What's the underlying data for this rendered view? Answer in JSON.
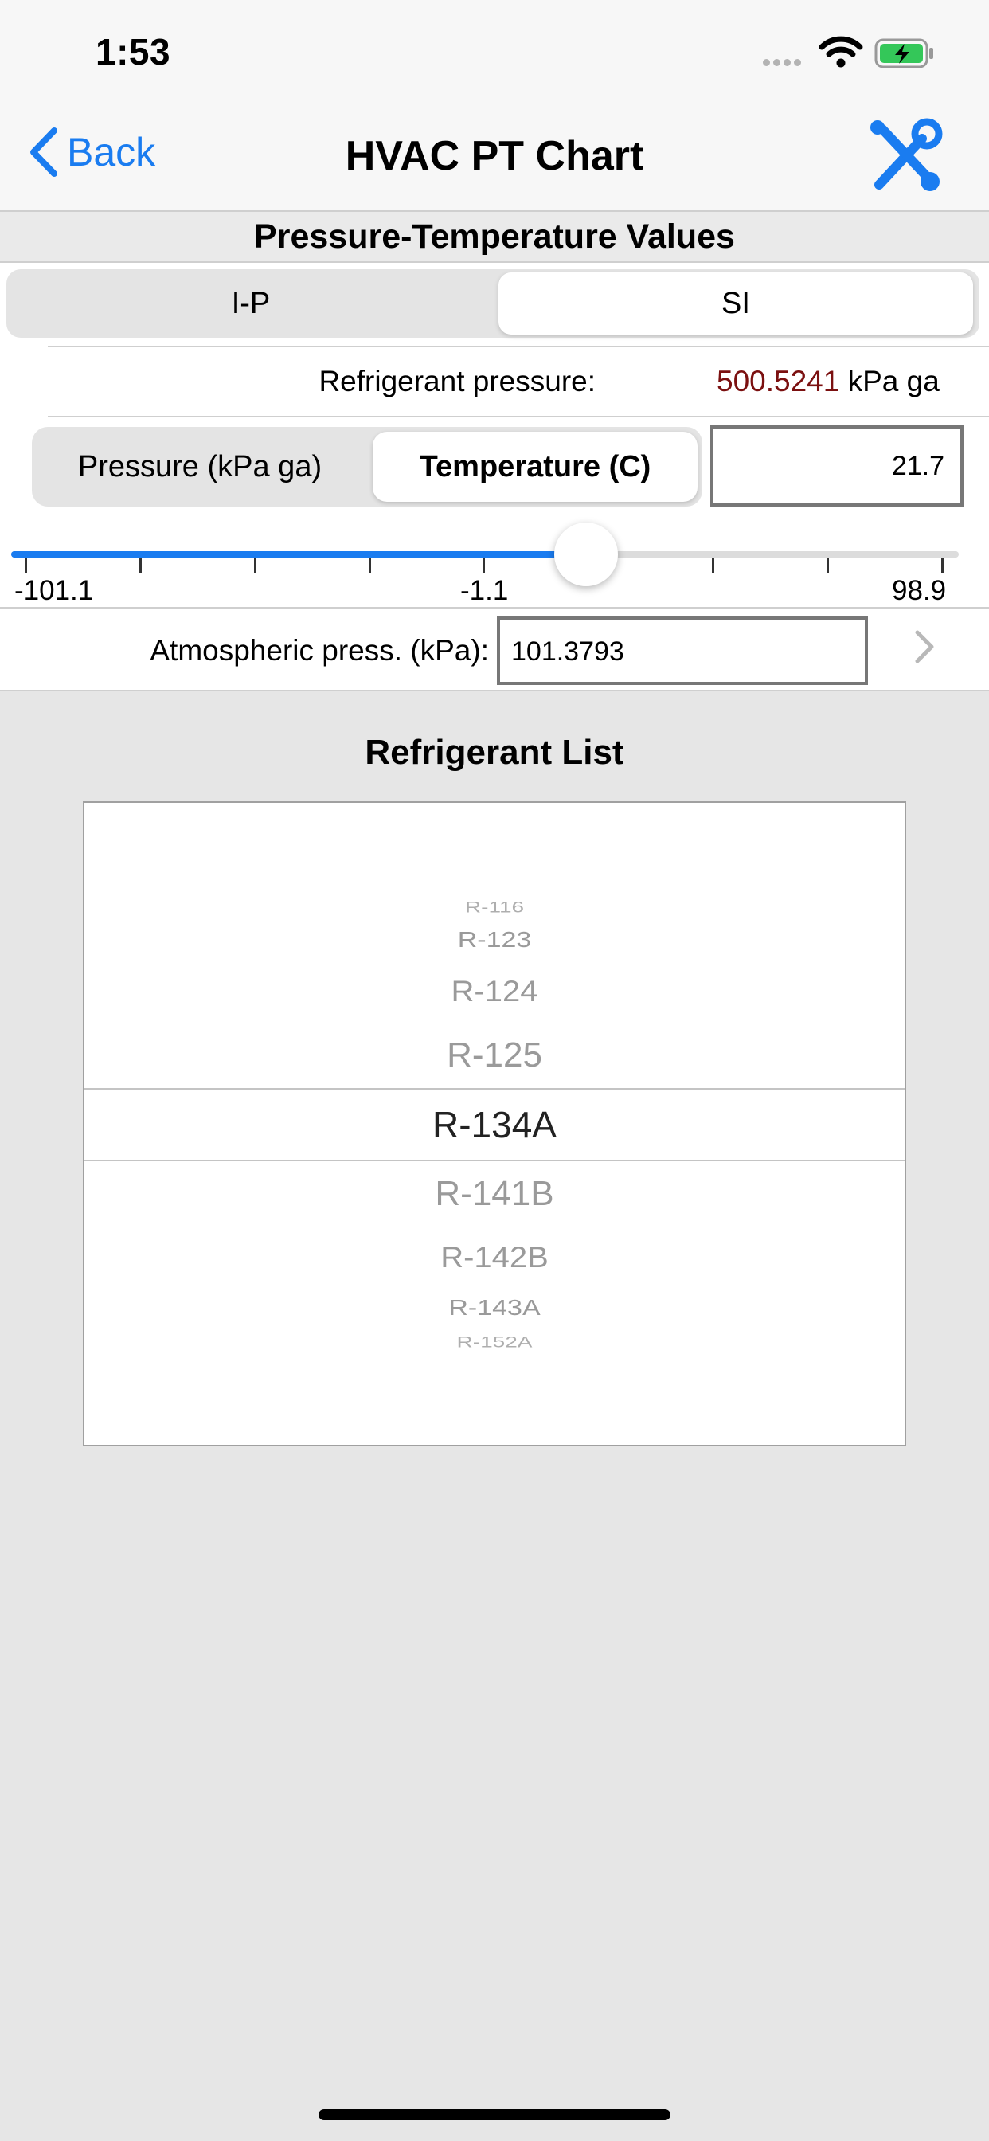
{
  "status": {
    "time": "1:53"
  },
  "nav": {
    "back_label": "Back",
    "title": "HVAC PT Chart"
  },
  "section_title": "Pressure-Temperature Values",
  "units": {
    "options": [
      "I-P",
      "SI"
    ],
    "selected": "SI"
  },
  "refrigerant_pressure": {
    "label": "Refrigerant pressure:",
    "value": "500.5241",
    "unit": "kPa ga"
  },
  "mode": {
    "options": [
      "Pressure (kPa ga)",
      "Temperature (C)"
    ],
    "selected": "Temperature (C)"
  },
  "temperature_input": {
    "value": "21.7"
  },
  "slider": {
    "labels": {
      "min": "-101.1",
      "mid": "-1.1",
      "max": "98.9"
    },
    "position_fraction": 0.6
  },
  "atmospheric": {
    "label": "Atmospheric press. (kPa):",
    "value": "101.3793"
  },
  "list": {
    "title": "Refrigerant List",
    "items": [
      "R-116",
      "R-123",
      "R-124",
      "R-125",
      "R-134A",
      "R-141B",
      "R-142B",
      "R-143A",
      "R-152A"
    ],
    "selected": "R-134A"
  },
  "colors": {
    "accent": "#1a7cf0",
    "pressure_value": "#7b1010"
  }
}
